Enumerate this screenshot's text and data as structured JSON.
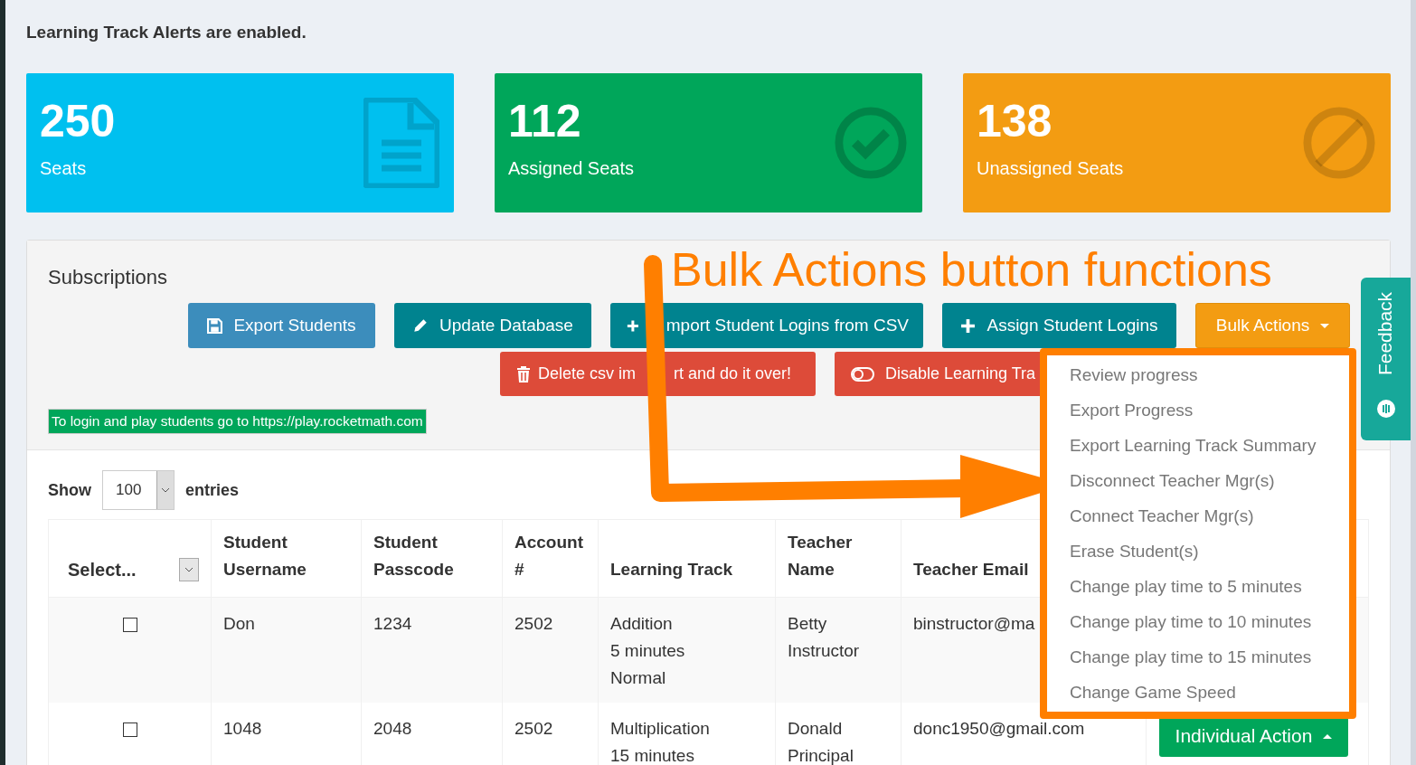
{
  "alert_text": "Learning Track Alerts are enabled.",
  "stats": [
    {
      "value": "250",
      "label": "Seats",
      "kind": "document",
      "color": "#00c0ef"
    },
    {
      "value": "112",
      "label": "Assigned Seats",
      "kind": "check",
      "color": "#00a65a"
    },
    {
      "value": "138",
      "label": "Unassigned Seats",
      "kind": "ban",
      "color": "#f39c12"
    }
  ],
  "panel": {
    "title": "Subscriptions",
    "buttons_row1": [
      {
        "label": [
          "Export Students"
        ],
        "kind": "save"
      },
      {
        "label": [
          "Update Database"
        ],
        "kind": "edit"
      },
      {
        "label": [
          "mport Student Logins from CSV"
        ],
        "kind": "add"
      },
      {
        "label": [
          "Assign Student Logins"
        ],
        "kind": "add"
      }
    ],
    "bulk_actions": {
      "label": "Bulk Actions",
      "expanded": true,
      "items": [
        "Review progress",
        "Export Progress",
        "Export Learning Track Summary",
        "Disconnect Teacher Mgr(s)",
        "Connect Teacher Mgr(s)",
        "Erase Student(s)",
        "Change play time to 5 minutes",
        "Change play time to 10 minutes",
        "Change play time to 15 minutes",
        "Change Game Speed"
      ]
    },
    "buttons_row2": [
      {
        "label": [
          "Delete csv im",
          "rt and do it over!"
        ],
        "kind": "delete"
      },
      {
        "label": [
          "Disable Learning Tra"
        ],
        "kind": "toggle"
      }
    ],
    "login_banner": "To login and play students go to https://play.rocketmath.com"
  },
  "table": {
    "show_label": "Show",
    "page_size": "100",
    "entries_label": "entries",
    "select_header": "Select...",
    "columns": [
      "Student Username",
      "Student Passcode",
      "Account #",
      "Learning Track",
      "Teacher Name",
      "Teacher Email"
    ],
    "rows": [
      {
        "checked": false,
        "cells": [
          [
            "Don"
          ],
          [
            "1234"
          ],
          [
            "2502"
          ],
          [
            "Addition",
            "5 minutes",
            "Normal"
          ],
          [
            "Betty",
            "Instructor"
          ],
          [
            "binstructor@ma"
          ]
        ]
      },
      {
        "checked": false,
        "cells": [
          [
            "1048"
          ],
          [
            "2048"
          ],
          [
            "2502"
          ],
          [
            "Multiplication",
            "15 minutes"
          ],
          [
            "Donald",
            "Principal"
          ],
          [
            "donc1950@gmail.com"
          ]
        ],
        "action": "Individual Action"
      }
    ]
  },
  "annotation": "Bulk Actions button functions",
  "feedback_tab": "Feedback"
}
